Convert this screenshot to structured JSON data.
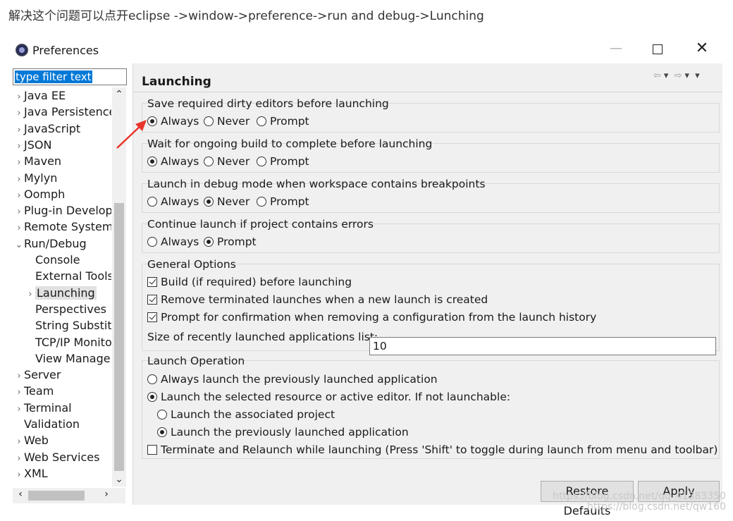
{
  "caption": "解决这个问题可以点开eclipse ->window->preference->run and debug->Lunching",
  "window": {
    "title": "Preferences",
    "minimize_glyph": "—",
    "close_glyph": "✕"
  },
  "filter": {
    "value": "type filter text"
  },
  "tree": {
    "items": [
      {
        "label": "Java EE",
        "chevron": "›"
      },
      {
        "label": "Java Persistence",
        "chevron": "›"
      },
      {
        "label": "JavaScript",
        "chevron": "›"
      },
      {
        "label": "JSON",
        "chevron": "›"
      },
      {
        "label": "Maven",
        "chevron": "›"
      },
      {
        "label": "Mylyn",
        "chevron": "›"
      },
      {
        "label": "Oomph",
        "chevron": "›"
      },
      {
        "label": "Plug-in Development",
        "chevron": "›"
      },
      {
        "label": "Remote Systems",
        "chevron": "›"
      },
      {
        "label": "Run/Debug",
        "chevron": "⌄"
      },
      {
        "label": "Console",
        "chevron": ""
      },
      {
        "label": "External Tools",
        "chevron": ""
      },
      {
        "label": "Launching",
        "chevron": "›"
      },
      {
        "label": "Perspectives",
        "chevron": ""
      },
      {
        "label": "String Substitution",
        "chevron": ""
      },
      {
        "label": "TCP/IP Monitor",
        "chevron": ""
      },
      {
        "label": "View Management",
        "chevron": ""
      },
      {
        "label": "Server",
        "chevron": "›"
      },
      {
        "label": "Team",
        "chevron": "›"
      },
      {
        "label": "Terminal",
        "chevron": "›"
      },
      {
        "label": "Validation",
        "chevron": ""
      },
      {
        "label": "Web",
        "chevron": "›"
      },
      {
        "label": "Web Services",
        "chevron": "›"
      },
      {
        "label": "XML",
        "chevron": "›"
      }
    ],
    "selected": "Launching"
  },
  "page": {
    "title": "Launching",
    "nav": {
      "back": "⇦",
      "back_menu": "▾",
      "forward": "⇨",
      "forward_menu": "▾",
      "view_menu": "▾"
    }
  },
  "groups": {
    "save_dirty": {
      "label": "Save required dirty editors before launching",
      "options": [
        "Always",
        "Never",
        "Prompt"
      ],
      "selected": "Always"
    },
    "wait_build": {
      "label": "Wait for ongoing build to complete before launching",
      "options": [
        "Always",
        "Never",
        "Prompt"
      ],
      "selected": "Always"
    },
    "debug_mode": {
      "label": "Launch in debug mode when workspace contains breakpoints",
      "options": [
        "Always",
        "Never",
        "Prompt"
      ],
      "selected": "Never"
    },
    "errors": {
      "label": "Continue launch if project contains errors",
      "options": [
        "Always",
        "Prompt"
      ],
      "selected": "Prompt"
    },
    "general": {
      "label": "General Options",
      "checks": [
        {
          "label": "Build (if required) before launching",
          "checked": true
        },
        {
          "label": "Remove terminated launches when a new launch is created",
          "checked": true
        },
        {
          "label": "Prompt for confirmation when removing a configuration from the launch history",
          "checked": true
        }
      ],
      "size_label": "Size of recently launched applications list:",
      "size_value": "10"
    },
    "launch_op": {
      "label": "Launch Operation",
      "opt_previous": "Always launch the previously launched application",
      "opt_selected": "Launch the selected resource or active editor. If not launchable:",
      "sub_associated": "Launch the associated project",
      "sub_previous": "Launch the previously launched application",
      "terminate": "Terminate and Relaunch while launching (Press 'Shift' to toggle during launch from menu and toolbar)",
      "selected": "selected",
      "sub_selected": "previous",
      "terminate_checked": false
    }
  },
  "buttons": {
    "restore": "Restore Defaults",
    "apply": "Apply"
  },
  "annotation": {
    "arrow_color": "#e8352b"
  },
  "watermark": {
    "line1": "https://blog.csdn.net/qq_41383350",
    "line2": "https://blog.csdn.net/qw160"
  },
  "scroll": {
    "up": "⌃",
    "down": "⌄",
    "left": "‹",
    "right": "›"
  }
}
